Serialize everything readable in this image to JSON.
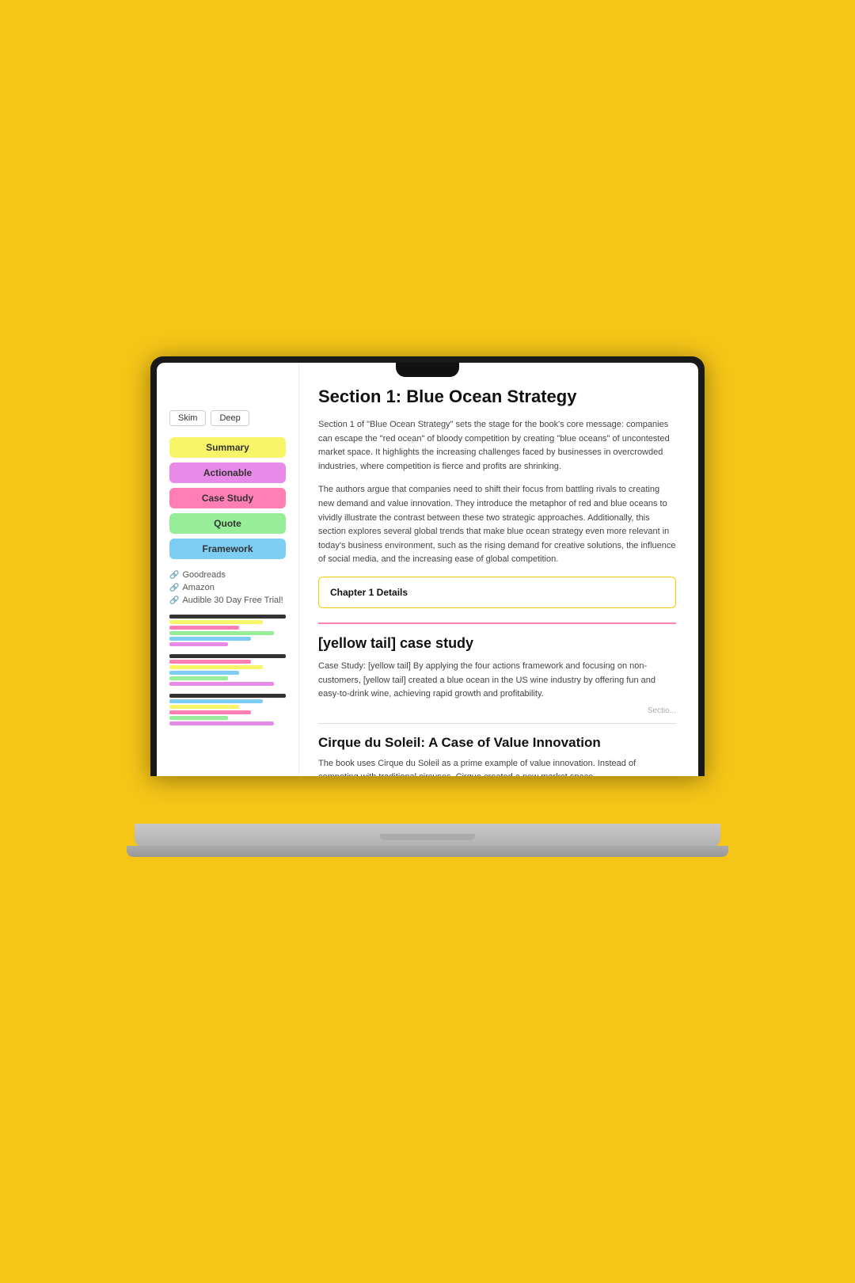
{
  "background": {
    "color": "#F5C518"
  },
  "filters": {
    "skim_label": "Skim",
    "deep_label": "Deep"
  },
  "tags": [
    {
      "label": "Summary",
      "class": "tag-summary"
    },
    {
      "label": "Actionable",
      "class": "tag-actionable"
    },
    {
      "label": "Case Study",
      "class": "tag-casestudy"
    },
    {
      "label": "Quote",
      "class": "tag-quote"
    },
    {
      "label": "Framework",
      "class": "tag-framework"
    }
  ],
  "sidebar_links": [
    {
      "label": "Goodreads"
    },
    {
      "label": "Amazon"
    },
    {
      "label": "Audible 30 Day Free Trial!"
    }
  ],
  "main": {
    "section_title": "Section 1: Blue Ocean Strategy",
    "section_body_1": "Section 1 of \"Blue Ocean Strategy\" sets the stage for the book's core message: companies can escape the \"red ocean\" of bloody competition by creating \"blue oceans\" of uncontested market space. It highlights the increasing challenges faced by businesses in overcrowded industries, where competition is fierce and profits are shrinking.",
    "section_body_2": "The authors argue that companies need to shift their focus from battling rivals to creating new demand and value innovation. They introduce the metaphor of red and blue oceans to vividly illustrate the contrast between these two strategic approaches. Additionally, this section explores several global trends that make blue ocean strategy even more relevant in today's business environment, such as the rising demand for creative solutions, the influence of social media, and the increasing ease of global competition.",
    "chapter_details_label": "Chapter 1 Details",
    "case_study_title": "[yellow tail] case study",
    "case_study_body": "Case Study: [yellow tail] By applying the four actions framework and focusing on non-customers, [yellow tail] created a blue ocean in the US wine industry by offering fun and easy-to-drink wine, achieving rapid growth and profitability.",
    "section_label": "Sectio...",
    "cirque_title": "Cirque du Soleil: A Case of Value Innovation",
    "cirque_body": "The book uses Cirque du Soleil as a prime example of value innovation. Instead of competing with traditional circuses, Cirque created a new market space..."
  }
}
